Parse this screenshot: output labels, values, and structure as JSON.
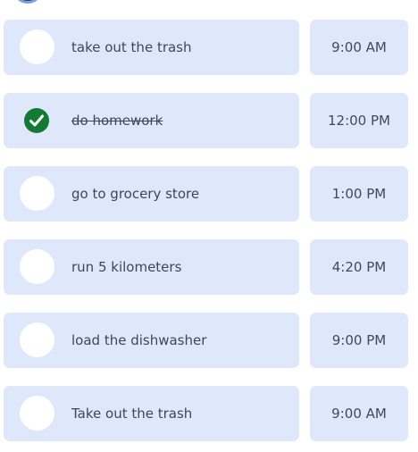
{
  "tasks": [
    {
      "text": "take out the trash",
      "time": "9:00 AM",
      "completed": false
    },
    {
      "text": "do homework",
      "time": "12:00 PM",
      "completed": true
    },
    {
      "text": "go to grocery store",
      "time": "1:00 PM",
      "completed": false
    },
    {
      "text": "run 5 kilometers",
      "time": "4:20 PM",
      "completed": false
    },
    {
      "text": "load the dishwasher",
      "time": "9:00 PM",
      "completed": false
    },
    {
      "text": "Take out the trash",
      "time": "9:00 AM",
      "completed": false
    }
  ],
  "colors": {
    "card_background": "#dfe8fb",
    "check_done": "#137a34",
    "text": "#3f4756",
    "avatar": "#1e3f73"
  }
}
